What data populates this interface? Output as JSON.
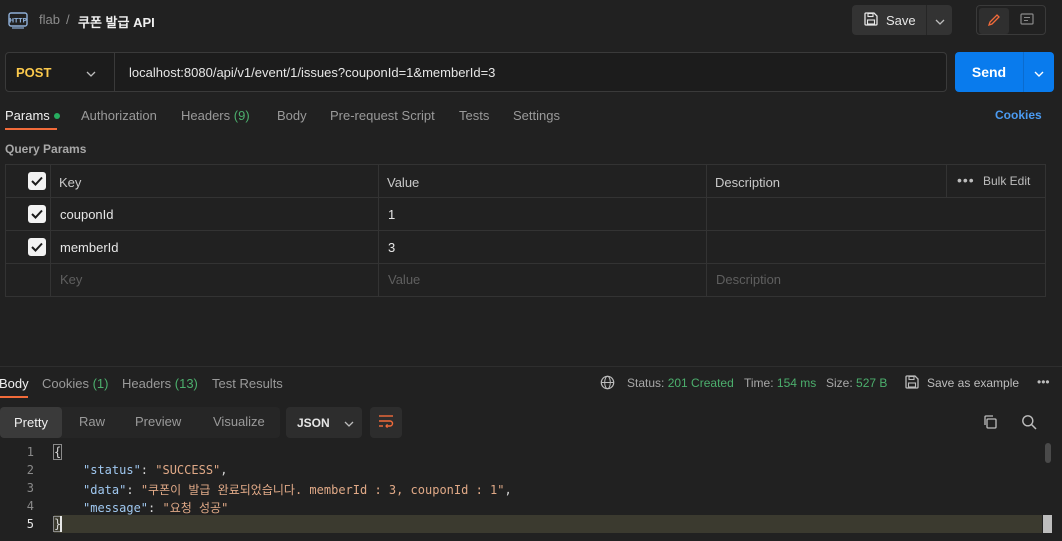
{
  "header": {
    "workspace": "flab",
    "separator": "/",
    "title": "쿠폰 발급 API",
    "save_label": "Save"
  },
  "request": {
    "method": "POST",
    "url": "localhost:8080/api/v1/event/1/issues?couponId=1&memberId=3",
    "send_label": "Send"
  },
  "tabs": {
    "params": "Params",
    "authorization": "Authorization",
    "headers": "Headers",
    "headers_count": "(9)",
    "body": "Body",
    "prerequest": "Pre-request Script",
    "tests": "Tests",
    "settings": "Settings",
    "cookies": "Cookies"
  },
  "query_params": {
    "label": "Query Params",
    "columns": [
      "Key",
      "Value",
      "Description"
    ],
    "bulk_edit": "Bulk Edit",
    "rows": [
      {
        "key": "couponId",
        "value": "1",
        "description": ""
      },
      {
        "key": "memberId",
        "value": "3",
        "description": ""
      }
    ],
    "placeholder": {
      "key": "Key",
      "value": "Value",
      "description": "Description"
    }
  },
  "response": {
    "tabs": {
      "body": "Body",
      "cookies": "Cookies",
      "cookies_count": "(1)",
      "headers": "Headers",
      "headers_count": "(13)",
      "test_results": "Test Results"
    },
    "status_label": "Status:",
    "status_value": "201 Created",
    "time_label": "Time:",
    "time_value": "154 ms",
    "size_label": "Size:",
    "size_value": "527 B",
    "save_example": "Save as example",
    "views": [
      "Pretty",
      "Raw",
      "Preview",
      "Visualize"
    ],
    "format": "JSON",
    "line_numbers": [
      "1",
      "2",
      "3",
      "4",
      "5"
    ],
    "code": {
      "open": "{",
      "status_key": "\"status\"",
      "status_val": "\"SUCCESS\"",
      "data_key": "\"data\"",
      "data_val": "\"쿠폰이 발급 완료되었습니다. memberId : 3, couponId : 1\"",
      "message_key": "\"message\"",
      "message_val": "\"요청 성공\"",
      "close": "}"
    }
  },
  "colors": {
    "accent": "#f26b3a",
    "send": "#097bed",
    "method": "#fbc94c",
    "success": "#4caf6d",
    "link": "#4b9bf2"
  }
}
